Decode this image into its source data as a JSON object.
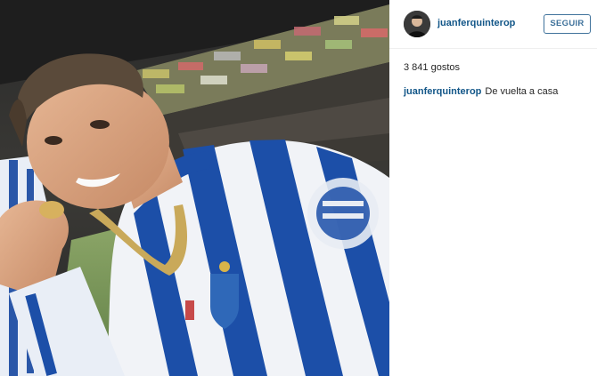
{
  "post": {
    "username": "juanferquinterop",
    "follow_label": "SEGUIR",
    "likes": "3 841 gostos",
    "caption": {
      "username": "juanferquinterop",
      "text": "De vuelta a casa"
    }
  },
  "photo": {
    "description_icon": "photo"
  },
  "colors": {
    "link": "#125688",
    "button": "#3f729b",
    "jersey_blue": "#1c4fa8"
  }
}
